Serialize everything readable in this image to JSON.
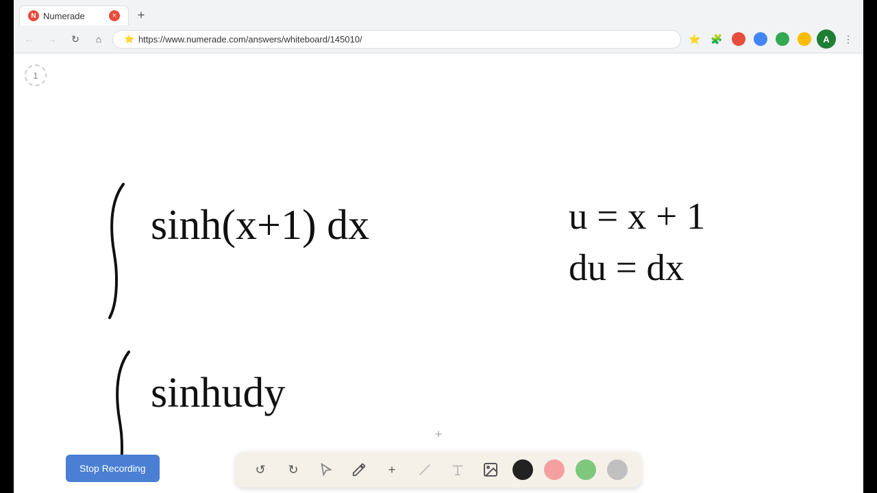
{
  "browser": {
    "tab": {
      "title": "Numerade",
      "favicon_letter": "N",
      "close_label": "×"
    },
    "new_tab_label": "+",
    "address": "https://www.numerade.com/answers/whiteboard/145010/",
    "nav": {
      "back_label": "←",
      "forward_label": "→",
      "refresh_label": "↻",
      "home_label": "⌂"
    }
  },
  "whiteboard": {
    "page_number": "1",
    "plus_label": "+"
  },
  "toolbar": {
    "undo_label": "↺",
    "redo_label": "↻",
    "select_label": "↖",
    "pen_label": "✏",
    "add_label": "+",
    "eraser_label": "╱",
    "text_label": "T",
    "image_label": "🖼",
    "colors": [
      "#222222",
      "#f4a0a0",
      "#7ec87e",
      "#c0c0c0"
    ]
  },
  "stop_recording": {
    "label": "Stop Recording"
  }
}
